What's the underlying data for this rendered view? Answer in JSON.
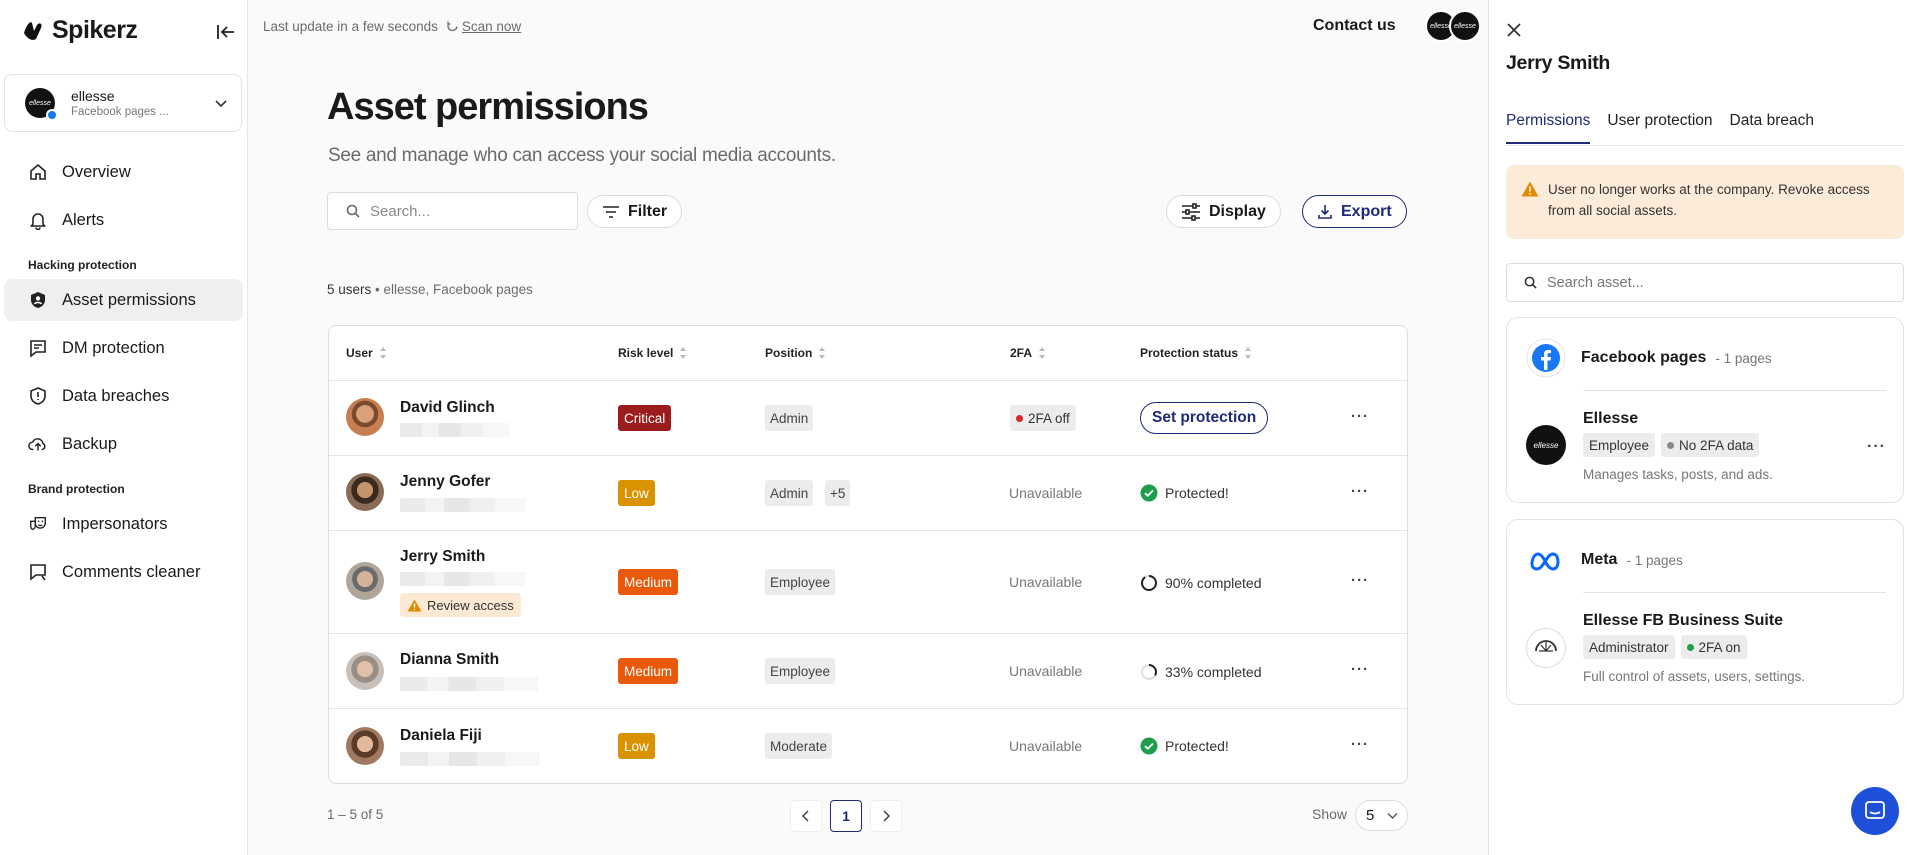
{
  "app": {
    "name": "Spikerz"
  },
  "account": {
    "name": "ellesse",
    "subtitle": "Facebook pages ...",
    "logo_text": "ellesse"
  },
  "sidebar": {
    "items": [
      {
        "label": "Overview",
        "icon": "home-icon"
      },
      {
        "label": "Alerts",
        "icon": "bell-icon"
      },
      {
        "label": "Asset permissions",
        "icon": "shield-person-icon",
        "active": true
      },
      {
        "label": "DM protection",
        "icon": "message-icon"
      },
      {
        "label": "Data breaches",
        "icon": "shield-icon"
      },
      {
        "label": "Backup",
        "icon": "cloud-upload-icon"
      },
      {
        "label": "Impersonators",
        "icon": "masks-icon"
      },
      {
        "label": "Comments cleaner",
        "icon": "comment-clean-icon"
      }
    ],
    "sections": {
      "hacking": "Hacking protection",
      "brand": "Brand protection"
    }
  },
  "topbar": {
    "last_update": "Last update in a few seconds",
    "scan_now": "Scan now",
    "contact": "Contact us"
  },
  "main": {
    "title": "Asset permissions",
    "subtitle": "See and manage who can access your social media accounts.",
    "search_placeholder": "Search...",
    "filter_label": "Filter",
    "display_label": "Display",
    "export_label": "Export",
    "summary_count": "5 users",
    "summary_scope": "ellesse, Facebook pages"
  },
  "table": {
    "columns": [
      "User",
      "Risk level",
      "Position",
      "2FA",
      "Protection status"
    ],
    "rows": [
      {
        "name": "David Glinch",
        "risk": "Critical",
        "position": "Admin",
        "tfa": "2FA off",
        "status": "Set protection"
      },
      {
        "name": "Jenny Gofer",
        "risk": "Low",
        "position": "Admin",
        "position_extra": "+5",
        "tfa": "Unavailable",
        "status": "Protected!"
      },
      {
        "name": "Jerry Smith",
        "risk": "Medium",
        "position": "Employee",
        "tfa": "Unavailable",
        "status": "90% completed",
        "review": "Review access"
      },
      {
        "name": "Dianna Smith",
        "risk": "Medium",
        "position": "Employee",
        "tfa": "Unavailable",
        "status": "33% completed"
      },
      {
        "name": "Daniela Fiji",
        "risk": "Low",
        "position": "Moderate",
        "tfa": "Unavailable",
        "status": "Protected!"
      }
    ]
  },
  "pagination": {
    "range": "1 – 5 of 5",
    "current_page": "1",
    "show_label": "Show",
    "show_value": "5"
  },
  "panel": {
    "title": "Jerry Smith",
    "tabs": [
      "Permissions",
      "User protection",
      "Data breach"
    ],
    "warning": "User no longer works at the company. Revoke access from all social assets.",
    "search_placeholder": "Search asset...",
    "groups": [
      {
        "title": "Facebook pages",
        "count": "1 pages",
        "asset": {
          "name": "Ellesse",
          "tags": [
            "Employee",
            "No 2FA data"
          ],
          "desc": "Manages tasks, posts, and ads."
        }
      },
      {
        "title": "Meta",
        "count": "1 pages",
        "asset": {
          "name": "Ellesse FB Business Suite",
          "tags": [
            "Administrator",
            "2FA on"
          ],
          "desc": "Full control of assets, users, settings."
        }
      }
    ]
  },
  "colors": {
    "accent": "#1e2a78",
    "critical": "#9b1c1c",
    "low": "#d99300",
    "medium": "#e8590c",
    "warning_bg": "#fcebd8",
    "protected": "#1e9e4a"
  }
}
